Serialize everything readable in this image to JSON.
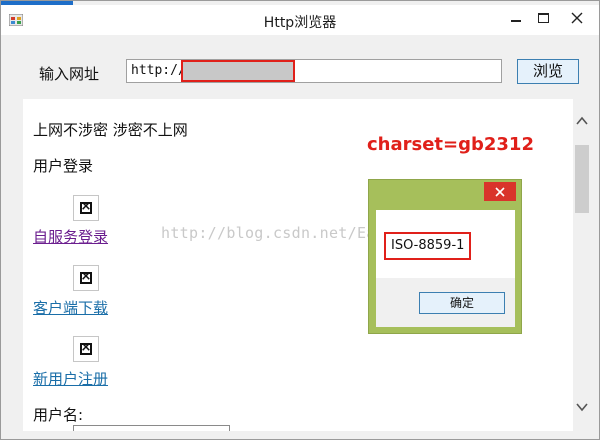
{
  "window": {
    "title": "Http浏览器"
  },
  "toolbar": {
    "url_label": "输入网址",
    "url_value": "http://",
    "browse_label": "浏览"
  },
  "page": {
    "slogan": "上网不涉密 涉密不上网",
    "login_heading": "用户登录",
    "links": [
      {
        "label": "自服务登录",
        "visited": true
      },
      {
        "label": "客户端下载",
        "visited": false
      },
      {
        "label": "新用户注册",
        "visited": false
      }
    ],
    "username_label": "用户名:"
  },
  "annotation": {
    "charset": "charset=gb2312"
  },
  "watermark": "http://blog.csdn.net/Eastmount",
  "dialog": {
    "message": "ISO-8859-1",
    "ok_label": "确定"
  },
  "colors": {
    "highlight": "#e0201a",
    "dialog_frame": "#a6bf5b",
    "link": "#1a6ea8",
    "visited_link": "#6b1e8f"
  },
  "icons": [
    "app-icon",
    "minimize-icon",
    "maximize-icon",
    "close-icon",
    "broken-image-icon",
    "scroll-up-icon",
    "scroll-down-icon"
  ]
}
